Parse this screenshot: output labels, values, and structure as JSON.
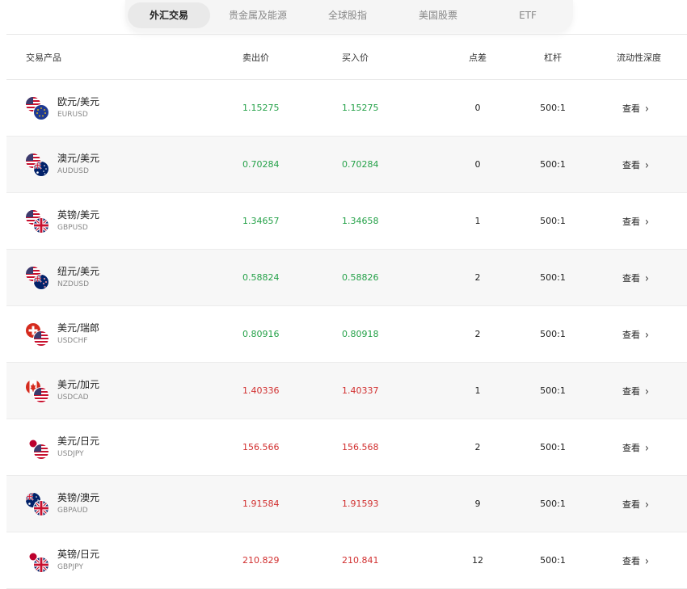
{
  "tabs": [
    {
      "label": "外汇交易",
      "active": true
    },
    {
      "label": "贵金属及能源",
      "active": false
    },
    {
      "label": "全球股指",
      "active": false
    },
    {
      "label": "美国股票",
      "active": false
    },
    {
      "label": "ETF",
      "active": false
    }
  ],
  "columns": {
    "product": "交易产品",
    "sell": "卖出价",
    "buy": "买入价",
    "spread": "点差",
    "leverage": "杠杆",
    "depth": "流动性深度"
  },
  "colors": {
    "up": "#24a148",
    "down": "#d12f2f",
    "active_tab_bg": "#e9e9e9"
  },
  "rows": [
    {
      "name": "欧元/美元",
      "code": "EURUSD",
      "sell": "1.15275",
      "buy": "1.15275",
      "spread": "0",
      "leverage": "500:1",
      "view": "查看",
      "trend": "up",
      "flags": [
        "us-flag-icon",
        "eu-flag-icon"
      ]
    },
    {
      "name": "澳元/美元",
      "code": "AUDUSD",
      "sell": "0.70284",
      "buy": "0.70284",
      "spread": "0",
      "leverage": "500:1",
      "view": "查看",
      "trend": "up",
      "flags": [
        "us-flag-icon",
        "au-flag-icon"
      ]
    },
    {
      "name": "英镑/美元",
      "code": "GBPUSD",
      "sell": "1.34657",
      "buy": "1.34658",
      "spread": "1",
      "leverage": "500:1",
      "view": "查看",
      "trend": "up",
      "flags": [
        "us-flag-icon",
        "uk-flag-icon"
      ]
    },
    {
      "name": "纽元/美元",
      "code": "NZDUSD",
      "sell": "0.58824",
      "buy": "0.58826",
      "spread": "2",
      "leverage": "500:1",
      "view": "查看",
      "trend": "up",
      "flags": [
        "us-flag-icon",
        "nz-flag-icon"
      ]
    },
    {
      "name": "美元/瑞郎",
      "code": "USDCHF",
      "sell": "0.80916",
      "buy": "0.80918",
      "spread": "2",
      "leverage": "500:1",
      "view": "查看",
      "trend": "up",
      "flags": [
        "ch-flag-icon",
        "us-flag-icon"
      ]
    },
    {
      "name": "美元/加元",
      "code": "USDCAD",
      "sell": "1.40336",
      "buy": "1.40337",
      "spread": "1",
      "leverage": "500:1",
      "view": "查看",
      "trend": "down",
      "flags": [
        "ca-flag-icon",
        "us-flag-icon"
      ]
    },
    {
      "name": "美元/日元",
      "code": "USDJPY",
      "sell": "156.566",
      "buy": "156.568",
      "spread": "2",
      "leverage": "500:1",
      "view": "查看",
      "trend": "down",
      "flags": [
        "jp-flag-icon",
        "us-flag-icon"
      ]
    },
    {
      "name": "英镑/澳元",
      "code": "GBPAUD",
      "sell": "1.91584",
      "buy": "1.91593",
      "spread": "9",
      "leverage": "500:1",
      "view": "查看",
      "trend": "down",
      "flags": [
        "au-flag-icon",
        "uk-flag-icon"
      ]
    },
    {
      "name": "英镑/日元",
      "code": "GBPJPY",
      "sell": "210.829",
      "buy": "210.841",
      "spread": "12",
      "leverage": "500:1",
      "view": "查看",
      "trend": "down",
      "flags": [
        "jp-flag-icon",
        "uk-flag-icon"
      ]
    }
  ]
}
